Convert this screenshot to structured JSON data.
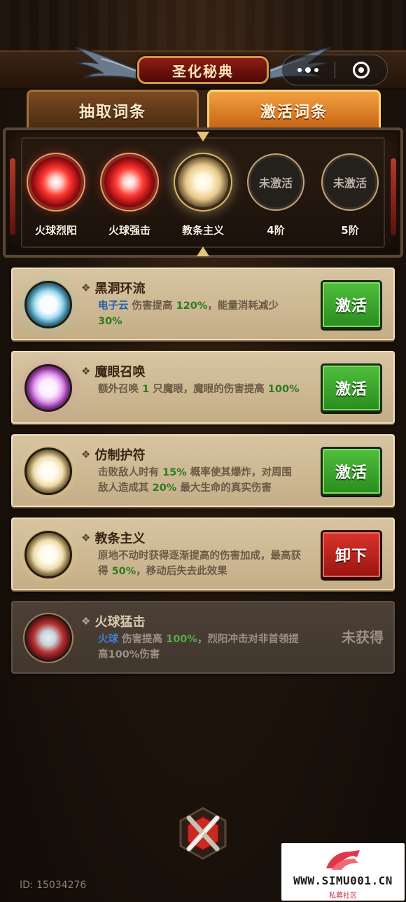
{
  "header": {
    "title": "圣化秘典"
  },
  "tabs": [
    {
      "label": "抽取词条",
      "active": false
    },
    {
      "label": "激活词条",
      "active": true
    }
  ],
  "stages": [
    {
      "label": "火球烈阳",
      "state": "red-orb"
    },
    {
      "label": "火球强击",
      "state": "red-orb"
    },
    {
      "label": "教条主义",
      "state": "gold-orb-selected"
    },
    {
      "label": "4阶",
      "state": "locked",
      "orb_text": "未激活"
    },
    {
      "label": "5阶",
      "state": "locked",
      "orb_text": "未激活"
    }
  ],
  "cards": [
    {
      "title": "黑洞环流",
      "orb_color": "cyan",
      "desc": [
        {
          "t": "电子云",
          "c": "blue"
        },
        {
          "t": " 伤害提高 ",
          "c": ""
        },
        {
          "t": "120%",
          "c": "green"
        },
        {
          "t": "，能量消耗减少 ",
          "c": ""
        },
        {
          "t": "30%",
          "c": "green"
        }
      ],
      "action": "激活",
      "action_type": "green"
    },
    {
      "title": "魔眼召唤",
      "orb_color": "purple",
      "desc": [
        {
          "t": "额外召唤 ",
          "c": ""
        },
        {
          "t": "1",
          "c": "green"
        },
        {
          "t": " 只魔眼，魔眼的伤害提高 ",
          "c": ""
        },
        {
          "t": "100%",
          "c": "green"
        }
      ],
      "action": "激活",
      "action_type": "green"
    },
    {
      "title": "仿制护符",
      "orb_color": "gold",
      "desc": [
        {
          "t": "击败敌人时有 ",
          "c": ""
        },
        {
          "t": "15%",
          "c": "green"
        },
        {
          "t": " 概率使其爆炸，对周围敌人造成其 ",
          "c": ""
        },
        {
          "t": "20%",
          "c": "green"
        },
        {
          "t": " 最大生命的真实伤害",
          "c": ""
        }
      ],
      "action": "激活",
      "action_type": "green"
    },
    {
      "title": "教条主义",
      "orb_color": "gold",
      "desc": [
        {
          "t": "原地不动时获得逐渐提高的伤害加成，最高获得 ",
          "c": ""
        },
        {
          "t": "50%",
          "c": "green"
        },
        {
          "t": "，移动后失去此效果",
          "c": ""
        }
      ],
      "action": "卸下",
      "action_type": "red"
    },
    {
      "title": "火球猛击",
      "orb_color": "red",
      "dim": true,
      "desc": [
        {
          "t": "火球",
          "c": "blue"
        },
        {
          "t": " 伤害提高 ",
          "c": ""
        },
        {
          "t": "100%",
          "c": "green"
        },
        {
          "t": "，烈阳冲击对非首领提高100%伤害",
          "c": ""
        }
      ],
      "status": "未获得"
    }
  ],
  "footer": {
    "user_id": "ID: 15034276"
  },
  "watermark": {
    "text": "WWW.SIMU001.CN",
    "sub": "私募社区"
  },
  "icons": {
    "card_title_marker": "diamond-ornament-icon",
    "menu": "more-dots-icon",
    "close": "close-target-icon",
    "emblem": "crossed-swords-emblem-icon"
  },
  "colors": {
    "accent_orange": "#e88a2c",
    "activate_green": "#3aa82c",
    "unequip_red": "#c42a22",
    "highlight_blue": "#2460a8",
    "highlight_green": "#2d7a20"
  }
}
